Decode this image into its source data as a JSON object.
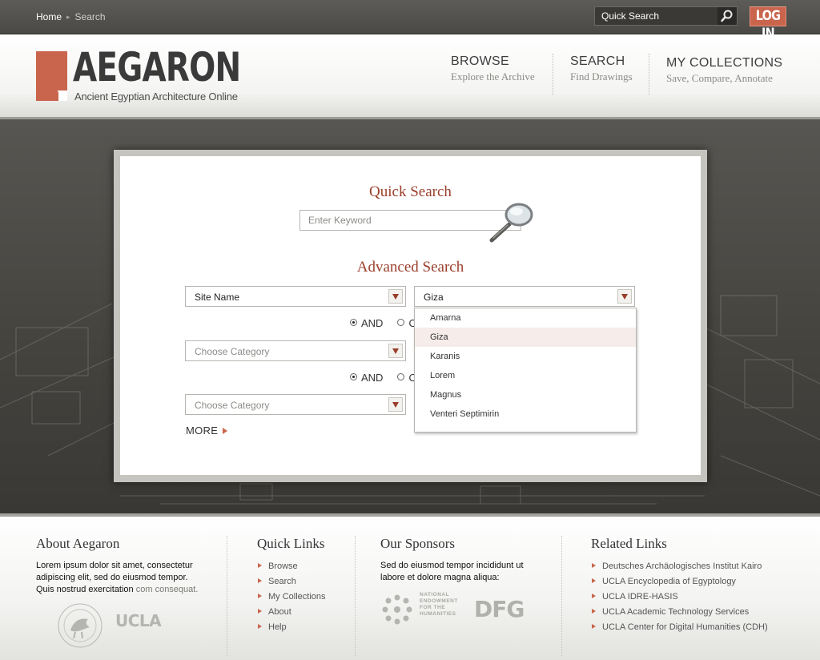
{
  "topbar": {
    "breadcrumb": [
      "Home",
      "Search"
    ],
    "breadcrumb_sep": "▸",
    "quick_search_placeholder": "Quick Search",
    "login_label": "LOG IN"
  },
  "header": {
    "logo_title": "AEGARON",
    "logo_subtitle": "Ancient Egyptian Architecture Online",
    "nav": [
      {
        "title": "BROWSE",
        "subtitle": "Explore the Archive"
      },
      {
        "title": "SEARCH",
        "subtitle": "Find Drawings"
      },
      {
        "title": "MY COLLECTIONS",
        "subtitle": "Save, Compare, Annotate"
      }
    ]
  },
  "search": {
    "quick_title": "Quick Search",
    "keyword_placeholder": "Enter Keyword",
    "advanced_title": "Advanced Search",
    "row1": {
      "field": "Site Name",
      "value": "Giza"
    },
    "row2": {
      "field_placeholder": "Choose Category"
    },
    "row3": {
      "field_placeholder": "Choose Category"
    },
    "radio_and": "AND",
    "radio_or": "O",
    "more": "MORE",
    "dropdown_options": [
      "Amarna",
      "Giza",
      "Karanis",
      "Lorem",
      "Magnus",
      "Venteri Septimirin"
    ],
    "dropdown_selected": "Giza"
  },
  "footer": {
    "about": {
      "title": "About Aegaron",
      "text": "Lorem ipsum dolor sit amet, consectetur adipiscing elit, sed do eiusmod tempor. Quis nostrud exercitation",
      "link": "com consequat.",
      "ucla": "UCLA"
    },
    "quick_links": {
      "title": "Quick Links",
      "items": [
        "Browse",
        "Search",
        "My Collections",
        "About",
        "Help"
      ]
    },
    "sponsors": {
      "title": "Our Sponsors",
      "text": "Sed do eiusmod tempor incididunt ut labore et dolore magna aliqua:",
      "neh": [
        "NATIONAL",
        "ENDOWMENT",
        "FOR THE",
        "HUMANITIES"
      ],
      "dfg": "DFG"
    },
    "related": {
      "title": "Related Links",
      "items": [
        "Deutsches Archäologisches Institut Kairo",
        "UCLA Encyclopedia of Egyptology",
        "UCLA IDRE-HASIS",
        "UCLA Academic Technology Services",
        "UCLA Center for Digital Humanities (CDH)"
      ]
    }
  },
  "colors": {
    "accent": "#c9654d",
    "heading_red": "#9b3f2c",
    "topbar": "#4f4e4b"
  }
}
